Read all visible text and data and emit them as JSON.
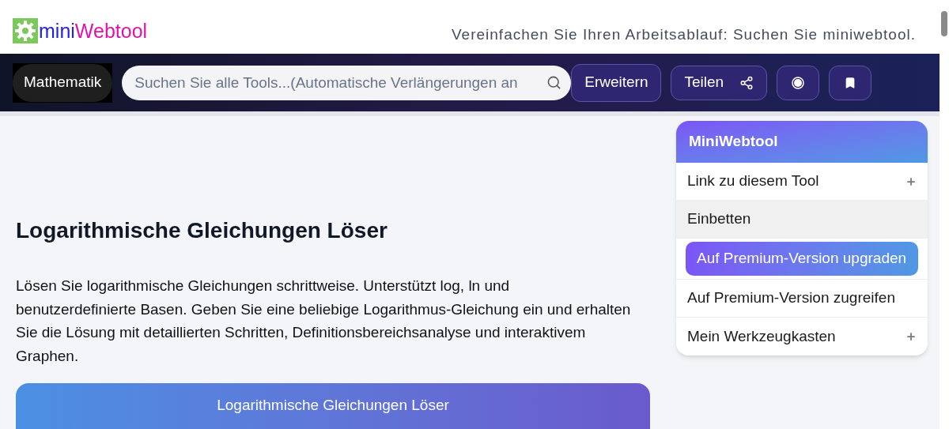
{
  "header": {
    "logo": {
      "part_1": "mini",
      "part_2": "Webtool"
    },
    "tagline": "Vereinfachen Sie Ihren Arbeitsablauf: Suchen Sie miniwebtool."
  },
  "navbar": {
    "category": "Mathematik",
    "search": {
      "placeholder": "Suchen Sie alle Tools...(Automatische Verlängerungen an"
    },
    "buttons": [
      {
        "kind": "text",
        "label": "Erweitern"
      },
      {
        "kind": "share",
        "label": "Teilen"
      },
      {
        "kind": "circle"
      },
      {
        "kind": "bookmark"
      }
    ]
  },
  "main": {
    "title": "Logarithmische Gleichungen Löser",
    "description": "Lösen Sie logarithmische Gleichungen schrittweise. Unterstützt log, ln und benutzerdefinierte Basen. Geben Sie eine beliebige Logarithmus-Gleichung ein und erhalten Sie die Lösung mit detaillierten Schritten, Definitionsbereichsanalyse und interaktivem Graphen.",
    "card_title": "Logarithmische Gleichungen Löser"
  },
  "sidebar": {
    "title": "MiniWebtool",
    "items": [
      {
        "kind": "expandable",
        "label": "Link zu diesem Tool",
        "highlighted": false
      },
      {
        "kind": "plain",
        "label": "Einbetten",
        "highlighted": true
      },
      {
        "kind": "premium",
        "label": "Auf Premium-Version upgraden",
        "highlighted": false
      },
      {
        "kind": "plain",
        "label": "Auf Premium-Version zugreifen",
        "highlighted": false
      },
      {
        "kind": "expandable",
        "label": "Mein Werkzeugkasten",
        "highlighted": false
      }
    ]
  }
}
